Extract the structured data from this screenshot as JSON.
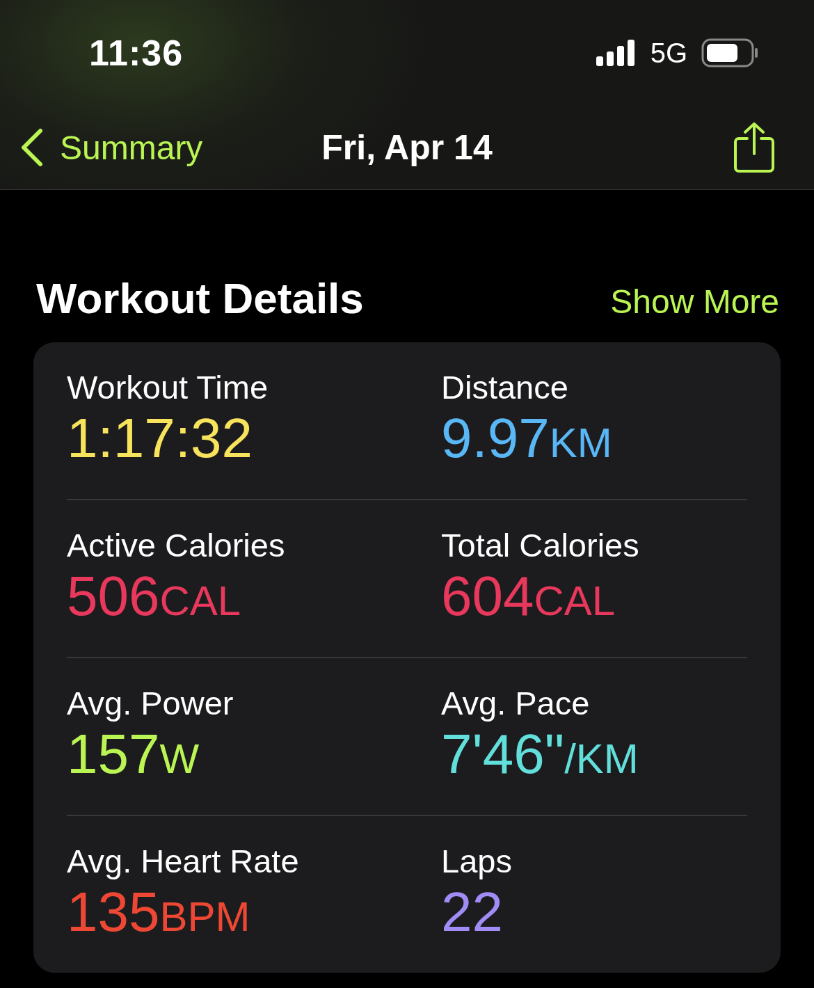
{
  "status_bar": {
    "time": "11:36",
    "network": "5G"
  },
  "nav": {
    "back": "Summary",
    "title": "Fri, Apr 14"
  },
  "section": {
    "title": "Workout Details",
    "action": "Show More"
  },
  "metrics": [
    {
      "label": "Workout Time",
      "value": "1:17:32",
      "color": "#f7e35c"
    },
    {
      "label": "Distance",
      "value": "9.97",
      "unit": "KM",
      "color": "#5ab7f6"
    },
    {
      "label": "Active Calories",
      "value": "506",
      "unit": "CAL",
      "color": "#e8385c"
    },
    {
      "label": "Total Calories",
      "value": "604",
      "unit": "CAL",
      "color": "#e8385c"
    },
    {
      "label": "Avg. Power",
      "value": "157",
      "unit": "W",
      "color": "#baf554"
    },
    {
      "label": "Avg. Pace",
      "value": "7'46\"",
      "unit": "/KM",
      "color": "#62dfdb"
    },
    {
      "label": "Avg. Heart Rate",
      "value": "135",
      "unit": "BPM",
      "color": "#ee4834"
    },
    {
      "label": "Laps",
      "value": "22",
      "color": "#a18cf5"
    }
  ]
}
